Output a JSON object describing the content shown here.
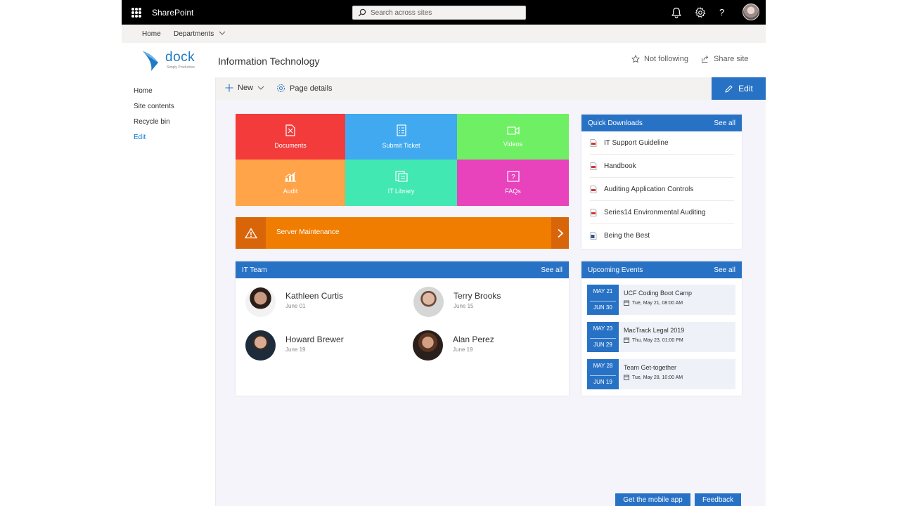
{
  "suite": {
    "app_name": "SharePoint",
    "search_placeholder": "Search across sites"
  },
  "hubnav": {
    "home": "Home",
    "departments": "Departments"
  },
  "site": {
    "logo_word": "dock",
    "logo_tagline": "Simply Productive",
    "title": "Information Technology",
    "not_following": "Not following",
    "share_site": "Share site"
  },
  "leftnav": {
    "items": [
      "Home",
      "Site contents",
      "Recycle bin",
      "Edit"
    ]
  },
  "command": {
    "new": "New",
    "page_details": "Page details",
    "edit": "Edit"
  },
  "tiles": [
    {
      "label": "Documents",
      "color": "#f43b3b",
      "icon": "document-icon"
    },
    {
      "label": "Submit Ticket",
      "color": "#41a9f0",
      "icon": "checklist-icon"
    },
    {
      "label": "Videos",
      "color": "#6ff064",
      "icon": "video-icon"
    },
    {
      "label": "Audit",
      "color": "#ffa449",
      "icon": "chart-icon"
    },
    {
      "label": "IT Library",
      "color": "#41e8b2",
      "icon": "library-icon"
    },
    {
      "label": "FAQs",
      "color": "#e842bd",
      "icon": "question-icon"
    }
  ],
  "alert": {
    "text": "Server Maintenance"
  },
  "team": {
    "title": "IT Team",
    "see_all": "See all",
    "members": [
      {
        "name": "Kathleen Curtis",
        "date": "June 01"
      },
      {
        "name": "Terry Brooks",
        "date": "June 15"
      },
      {
        "name": "Howard Brewer",
        "date": "June 19"
      },
      {
        "name": "Alan Perez",
        "date": "June 19"
      }
    ]
  },
  "downloads": {
    "title": "Quick Downloads",
    "see_all": "See all",
    "items": [
      {
        "label": "IT Support Guideline",
        "icon": "pdf-icon"
      },
      {
        "label": "Handbook",
        "icon": "pdf-icon"
      },
      {
        "label": "Auditing Application Controls",
        "icon": "pdf-icon"
      },
      {
        "label": "Series14 Environmental Auditing",
        "icon": "pdf-icon"
      },
      {
        "label": "Being the  Best",
        "icon": "word-icon"
      }
    ]
  },
  "events": {
    "title": "Upcoming Events",
    "see_all": "See all",
    "items": [
      {
        "start": "MAY 21",
        "end": "JUN 30",
        "title": "UCF Coding Boot Camp",
        "when": "Tue, May 21, 08:00 AM"
      },
      {
        "start": "MAY 23",
        "end": "JUN 29",
        "title": "MacTrack Legal 2019",
        "when": "Thu, May 23, 01:00 PM"
      },
      {
        "start": "MAY 28",
        "end": "JUN 19",
        "title": "Team Get-together",
        "when": "Tue, May 28, 10:00 AM"
      }
    ]
  },
  "footer": {
    "mobile_app": "Get the mobile app",
    "feedback": "Feedback"
  }
}
